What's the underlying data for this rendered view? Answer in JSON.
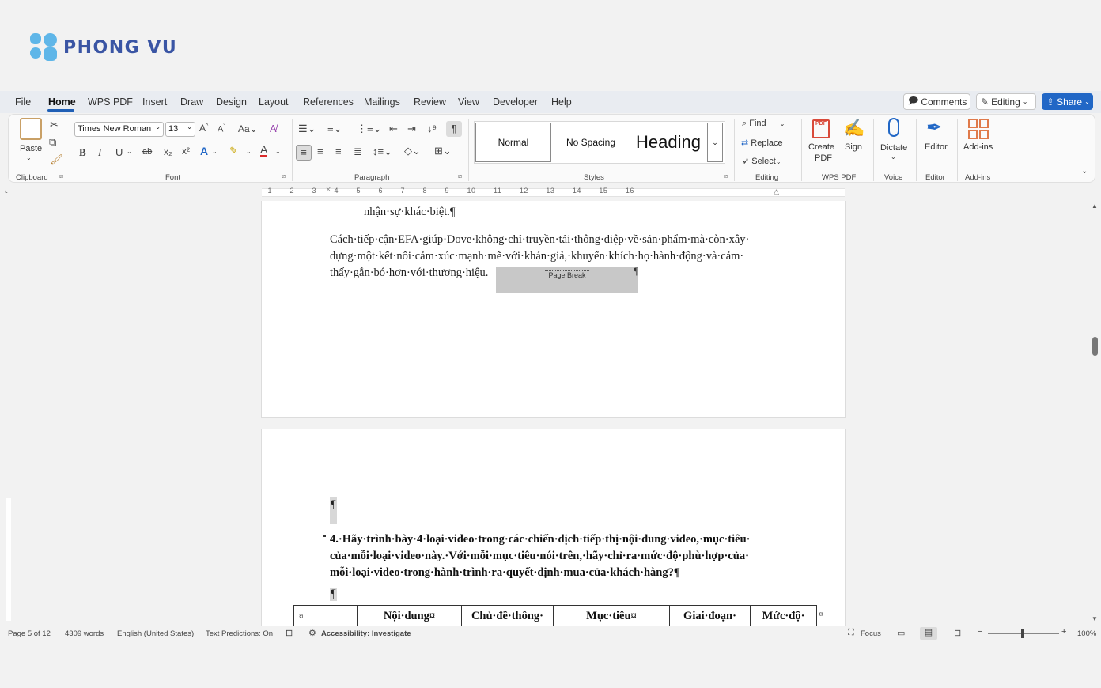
{
  "brand": {
    "name": "PHONG VU",
    "colors": {
      "blue": "#3a55a4",
      "lightblue": "#5fb6e8"
    }
  },
  "menu": {
    "tabs": [
      "File",
      "Home",
      "WPS PDF",
      "Insert",
      "Draw",
      "Design",
      "Layout",
      "References",
      "Mailings",
      "Review",
      "View",
      "Developer",
      "Help"
    ],
    "active_tab": "Home",
    "comments_label": "Comments",
    "editing_label": "Editing",
    "share_label": "Share"
  },
  "ribbon": {
    "clipboard": {
      "paste_label": "Paste",
      "group_label": "Clipboard"
    },
    "font": {
      "font_name": "Times New Roman",
      "font_size": "13",
      "group_label": "Font",
      "buttons": {
        "bold": "B",
        "italic": "I",
        "underline": "U",
        "strike": "ab",
        "subscript": "x₂",
        "superscript": "x²"
      }
    },
    "paragraph": {
      "group_label": "Paragraph"
    },
    "styles": {
      "items": [
        "Normal",
        "No Spacing",
        "Heading"
      ],
      "group_label": "Styles"
    },
    "editing": {
      "find": "Find",
      "replace": "Replace",
      "select": "Select",
      "group_label": "Editing"
    },
    "wps_pdf": {
      "create_pdf_line1": "Create",
      "create_pdf_line2": "PDF",
      "sign": "Sign",
      "group_label": "WPS PDF"
    },
    "voice": {
      "dictate": "Dictate",
      "group_label": "Voice"
    },
    "editor": {
      "editor": "Editor",
      "group_label": "Editor"
    },
    "addins": {
      "addins": "Add-ins",
      "group_label": "Add-ins"
    }
  },
  "ruler": {
    "marks": "· 1 · · · 2 · · · 3 · · · 4 · · · 5 · · · 6 · · · 7 · · · 8 · · · 9 · · · 10 · · · 11 · · · 12 · · · 13 · · · 14 · · · 15 · · · 16 ·"
  },
  "document": {
    "page1": {
      "line_top": "nhận·sự·khác·biệt.¶",
      "para": [
        "Cách·tiếp·cận·EFA·giúp·Dove·không·chỉ·truyền·tải·thông·điệp·về·sản·phẩm·mà·còn·xây·",
        "dựng·một·kết·nối·cảm·xúc·mạnh·mẽ·với·khán·giả,·khuyến·khích·họ·hành·động·và·cảm·",
        "thấy·gắn·bó·hơn·với·thương·hiệu."
      ],
      "page_break_label": "Page Break",
      "pilcrow": "¶"
    },
    "page2": {
      "pilcrow": "¶",
      "question": [
        "4.·Hãy·trình·bày·4·loại·video·trong·các·chiến·dịch·tiếp·thị·nội·dung·video,·mục·tiêu·",
        "của·mỗi·loại·video·này.·Với·mỗi·mục·tiêu·nói·trên,·hãy·chỉ·ra·mức·độ·phù·hợp·của·",
        "mỗi·loại·video·trong·hành·trình·ra·quyết·định·mua·của·khách·hàng?¶"
      ],
      "table_headers": [
        "¤",
        "Nội·dung¤",
        "Chủ·đề·thông·",
        "Mục·tiêu¤",
        "Giai·đoạn·",
        "Mức·độ·"
      ],
      "row_end": "¤"
    }
  },
  "status": {
    "page": "Page 5 of 12",
    "words": "4309 words",
    "language": "English (United States)",
    "predictions": "Text Predictions: On",
    "accessibility": "Accessibility: Investigate",
    "focus": "Focus",
    "zoom": "100%"
  }
}
